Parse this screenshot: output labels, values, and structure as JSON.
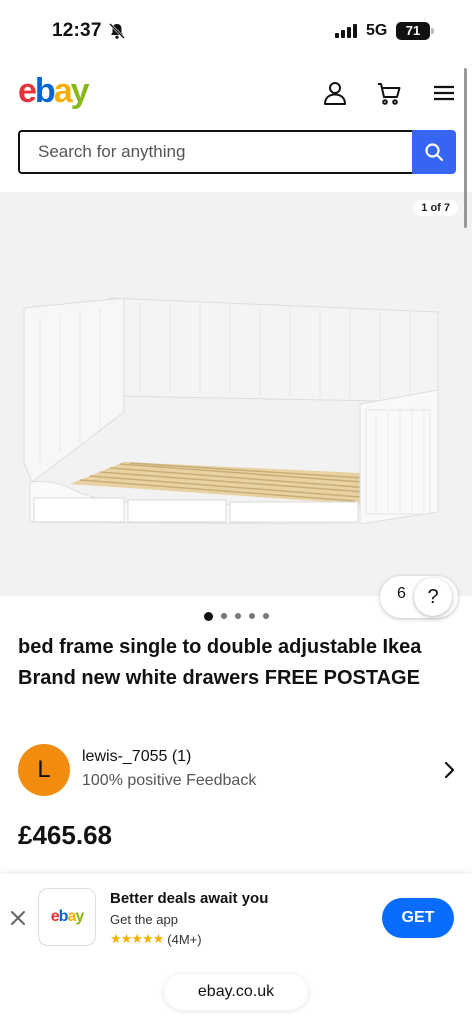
{
  "status_bar": {
    "time": "12:37",
    "network": "5G",
    "battery": "71"
  },
  "header": {
    "logo": {
      "e": "e",
      "b": "b",
      "a": "a",
      "y": "y"
    },
    "icons": [
      "user-icon",
      "cart-icon",
      "menu-icon"
    ]
  },
  "search": {
    "placeholder": "Search for anything",
    "button_icon": "search-icon"
  },
  "gallery": {
    "counter": "1 of 7",
    "watch_count": "6",
    "help_label": "?",
    "total_dots": 5,
    "active_dot": 0
  },
  "listing": {
    "title": "bed frame single to double adjustable Ikea Brand new white drawers FREE POSTAGE",
    "price": "£465.68"
  },
  "seller": {
    "initial": "L",
    "name": "lewis-_7055 (1)",
    "feedback": "100% positive Feedback"
  },
  "app_banner": {
    "title": "Better deals await you",
    "subtitle": "Get the app",
    "stars": "★★★★★",
    "rating_count": "(4M+)",
    "get_label": "GET"
  },
  "browser": {
    "url": "ebay.co.uk"
  },
  "colors": {
    "ebay_red": "#e53238",
    "ebay_blue": "#0064d2",
    "ebay_yellow": "#f5af02",
    "ebay_green": "#86b817",
    "search_button": "#3665f3",
    "get_button": "#0a6cff",
    "avatar": "#f28c0e"
  }
}
